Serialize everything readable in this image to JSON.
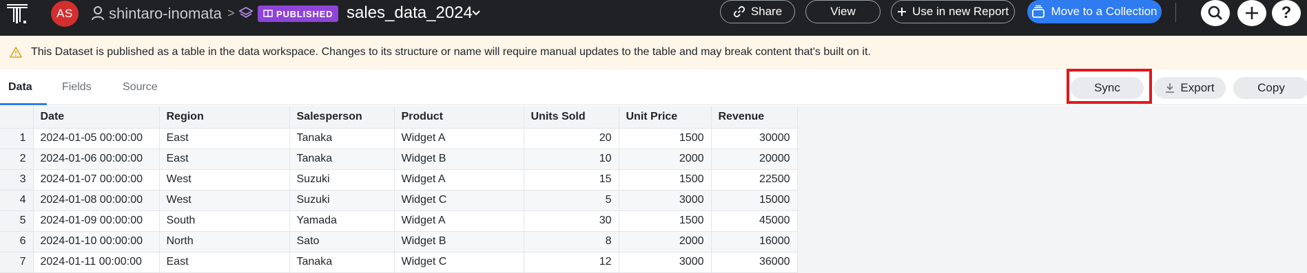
{
  "header": {
    "avatar_initials": "AS",
    "username": "shintaro-inomata",
    "breadcrumb_separator": ">",
    "status_badge": "PUBLISHED",
    "dataset_title": "sales_data_2024",
    "buttons": {
      "share": "Share",
      "view": "View",
      "use_in_report": "Use in new Report",
      "move_to_collection": "Move to a Collection"
    },
    "icons": [
      "logo",
      "user-icon",
      "layers-icon",
      "book-icon",
      "chevron-down-icon",
      "link-icon",
      "plus-icon",
      "collection-icon",
      "search-icon",
      "add-icon",
      "help-icon"
    ],
    "help_label": "?"
  },
  "banner": {
    "text": "This Dataset is published as a table in the data workspace. Changes to its structure or name will require manual updates to the table and may break content that's built on it."
  },
  "tabs": [
    {
      "label": "Data",
      "active": true
    },
    {
      "label": "Fields",
      "active": false
    },
    {
      "label": "Source",
      "active": false
    }
  ],
  "actions": {
    "sync": "Sync",
    "export": "Export",
    "copy": "Copy"
  },
  "table": {
    "columns": [
      "Date",
      "Region",
      "Salesperson",
      "Product",
      "Units Sold",
      "Unit Price",
      "Revenue"
    ],
    "rows": [
      [
        "1",
        "2024-01-05 00:00:00",
        "East",
        "Tanaka",
        "Widget A",
        "20",
        "1500",
        "30000"
      ],
      [
        "2",
        "2024-01-06 00:00:00",
        "East",
        "Tanaka",
        "Widget B",
        "10",
        "2000",
        "20000"
      ],
      [
        "3",
        "2024-01-07 00:00:00",
        "West",
        "Suzuki",
        "Widget A",
        "15",
        "1500",
        "22500"
      ],
      [
        "4",
        "2024-01-08 00:00:00",
        "West",
        "Suzuki",
        "Widget C",
        "5",
        "3000",
        "15000"
      ],
      [
        "5",
        "2024-01-09 00:00:00",
        "South",
        "Yamada",
        "Widget A",
        "30",
        "1500",
        "45000"
      ],
      [
        "6",
        "2024-01-10 00:00:00",
        "North",
        "Sato",
        "Widget B",
        "8",
        "2000",
        "16000"
      ],
      [
        "7",
        "2024-01-11 00:00:00",
        "East",
        "Tanaka",
        "Widget C",
        "12",
        "3000",
        "36000"
      ]
    ]
  },
  "colors": {
    "topbar": "#1f2124",
    "accent": "#2f7bf0",
    "published_badge": "#8e44d8",
    "avatar": "#d32f2f",
    "banner_bg": "#fdf6e9",
    "highlight": "#e3171c"
  }
}
